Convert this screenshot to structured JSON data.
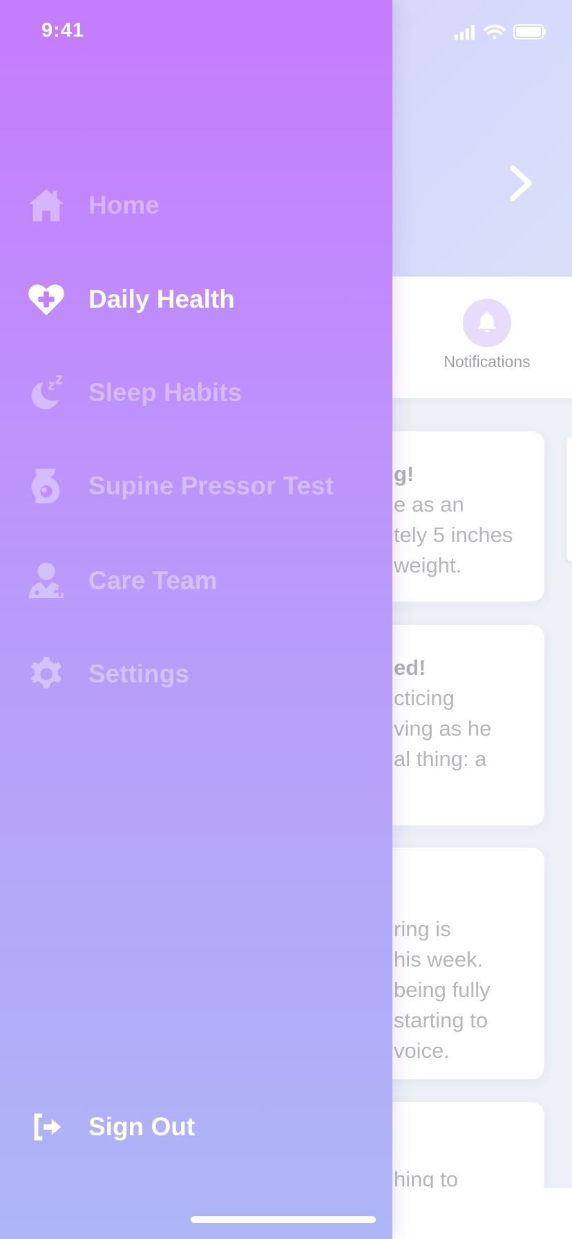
{
  "status_bar": {
    "time": "9:41"
  },
  "background": {
    "notifications_label": "Notifications",
    "cards": [
      {
        "title": "g!",
        "lines": [
          "e as an",
          "tely 5 inches",
          "weight."
        ]
      },
      {
        "title": "ed!",
        "lines": [
          "cticing",
          "ving as he",
          "al thing: a"
        ]
      },
      {
        "title": "",
        "lines": [
          "ring is",
          "his week.",
          "being fully",
          "starting to",
          "voice."
        ]
      },
      {
        "title": "",
        "lines": [
          "hing to"
        ]
      }
    ]
  },
  "drawer": {
    "items": [
      {
        "label": "Home",
        "icon": "home-icon",
        "active": false
      },
      {
        "label": "Daily Health",
        "icon": "heart-plus-icon",
        "active": true
      },
      {
        "label": "Sleep Habits",
        "icon": "moon-zzz-icon",
        "active": false
      },
      {
        "label": "Supine Pressor Test",
        "icon": "pregnancy-icon",
        "active": false
      },
      {
        "label": "Care Team",
        "icon": "doctor-icon",
        "active": false
      },
      {
        "label": "Settings",
        "icon": "gear-icon",
        "active": false
      }
    ],
    "sign_out": {
      "label": "Sign Out",
      "icon": "sign-out-icon"
    }
  },
  "colors": {
    "drawer_top": "#c57cfd",
    "drawer_bottom": "#aeb6f7",
    "active_text": "#ffffff",
    "inactive_text": "rgba(255,255,255,0.38)"
  }
}
